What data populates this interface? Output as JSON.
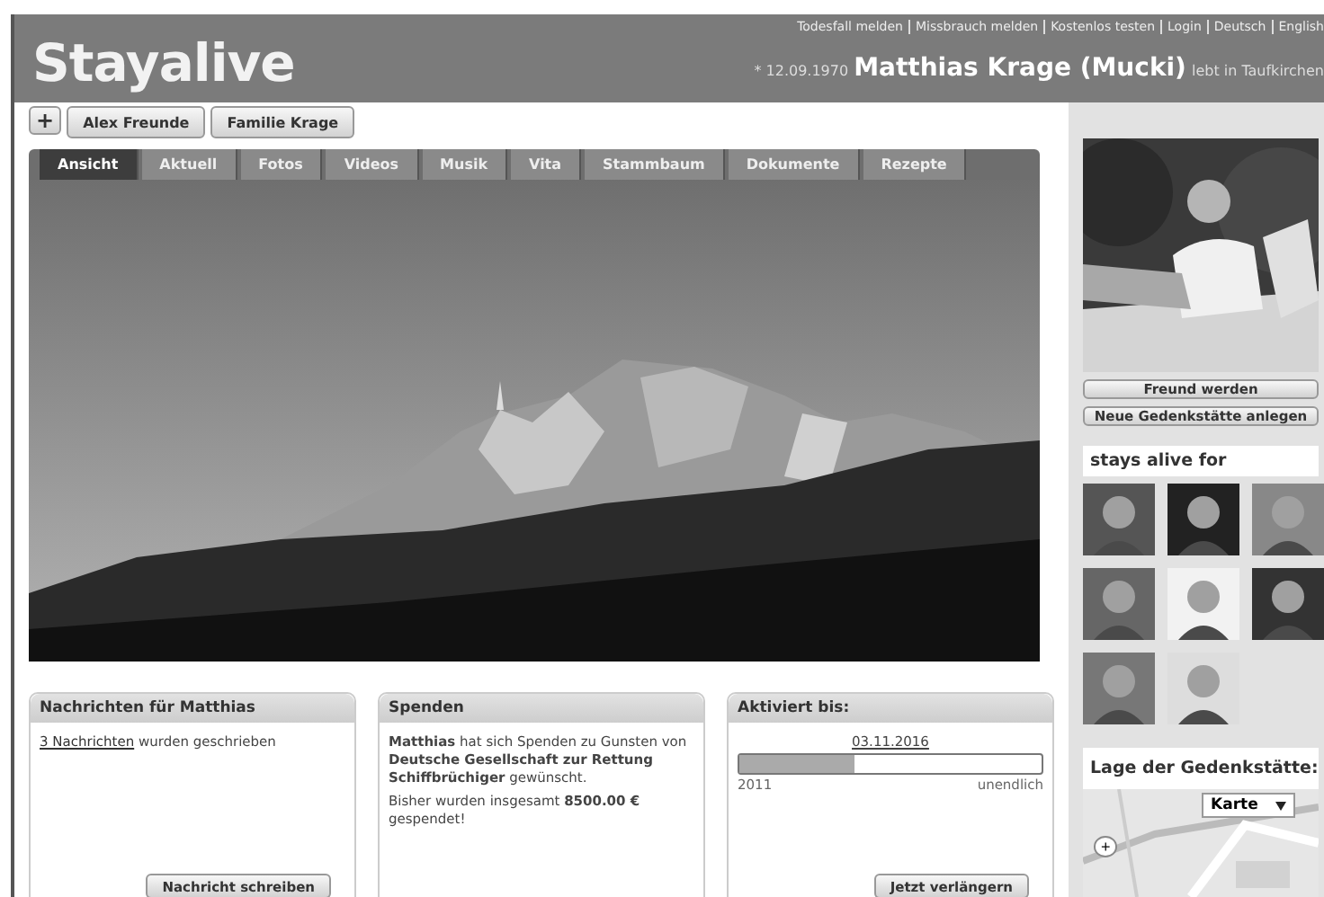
{
  "header": {
    "logo": "Stayalive",
    "links": [
      "Todesfall melden",
      "Missbrauch melden",
      "Kostenlos testen",
      "Login",
      "Deutsch",
      "English"
    ],
    "birth": "* 12.09.1970",
    "name": "Matthias Krage (Mucki)",
    "location": "lebt in Taufkirchen"
  },
  "friend_tabs": {
    "add": "+",
    "items": [
      "Alex Freunde",
      "Familie Krage"
    ]
  },
  "tabs": [
    {
      "label": "Ansicht",
      "selected": true
    },
    {
      "label": "Aktuell",
      "selected": false
    },
    {
      "label": "Fotos",
      "selected": false
    },
    {
      "label": "Videos",
      "selected": false
    },
    {
      "label": "Musik",
      "selected": false
    },
    {
      "label": "Vita",
      "selected": false
    },
    {
      "label": "Stammbaum",
      "selected": false
    },
    {
      "label": "Dokumente",
      "selected": false
    },
    {
      "label": "Rezepte",
      "selected": false
    }
  ],
  "panels": [
    {
      "kind": "messages",
      "title": "Nachrichten für Matthias",
      "link": "3 Nachrichten",
      "text": "wurden geschrieben",
      "button": "Nachricht schreiben"
    },
    {
      "kind": "donations",
      "title": "Spenden",
      "paragraphs": [
        "**Matthias** hat sich Spenden zu Gunsten von **Deutsche Gesellschaft zur Rettung Schiffbrüchiger** gewünscht.",
        "Bisher wurden insgesamt **8500.00 €** gespendet!"
      ]
    },
    {
      "kind": "activation",
      "title": "Aktiviert bis:",
      "date": "03.11.2016",
      "level": 0.38,
      "start": "2011",
      "end": "unendlich",
      "button": "Jetzt verlängern"
    }
  ],
  "sidebar": {
    "buttons": [
      "Freund werden",
      "Neue Gedenkstätte anlegen"
    ],
    "friends_title": "stays alive for",
    "friends": [
      {
        "kind": "picture"
      },
      {
        "kind": "picture"
      },
      {
        "kind": "picture"
      },
      {
        "kind": "picture"
      },
      {
        "kind": "picture"
      },
      {
        "kind": "picture"
      },
      {
        "kind": "picture"
      },
      {
        "kind": "picture"
      }
    ],
    "map": {
      "title": "Lage der Gedenkstätte:",
      "map_type": "Karte",
      "zoom_in": "+"
    }
  }
}
